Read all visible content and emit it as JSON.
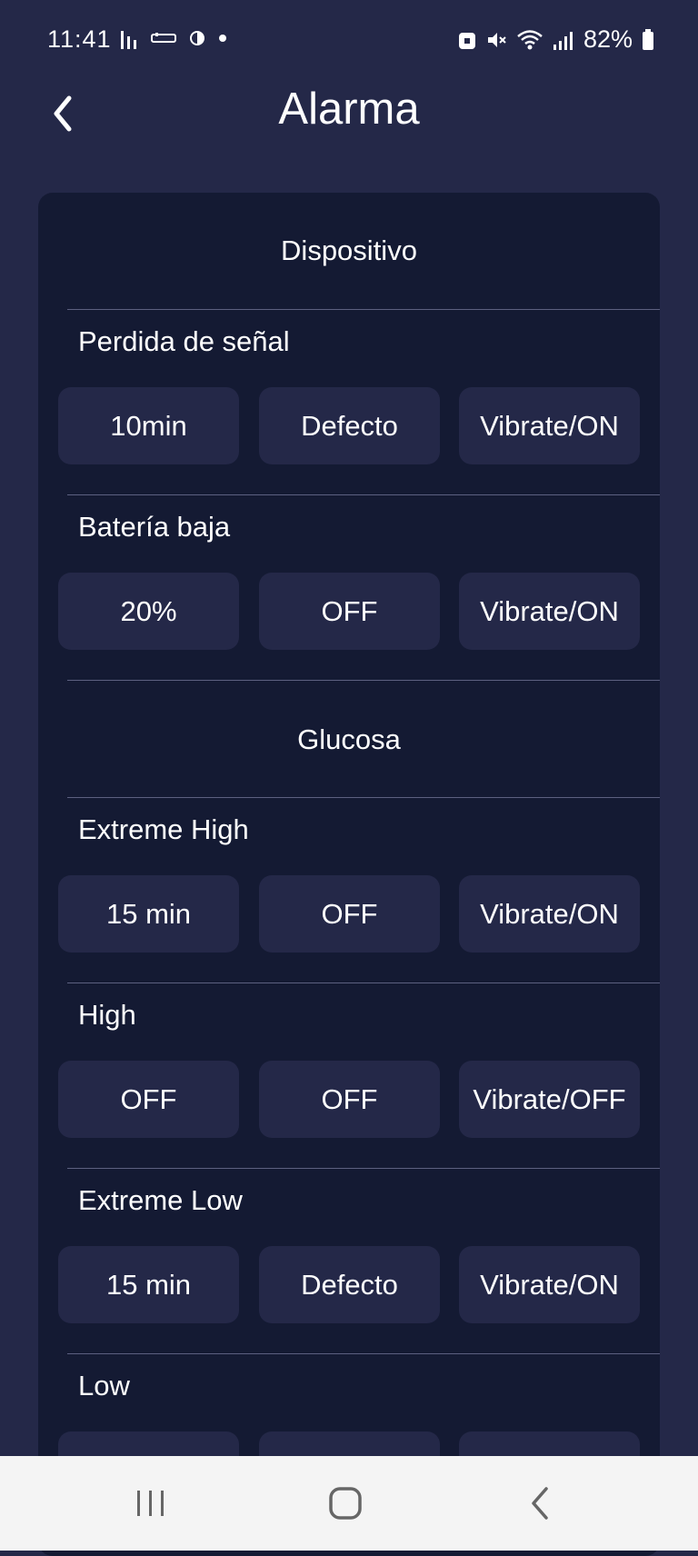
{
  "status": {
    "time": "11:41",
    "battery": "82%",
    "icons": [
      "bar-chart-icon",
      "sim-icon",
      "half-circle-icon",
      "dot-icon",
      "lock-badge-icon",
      "mute-icon",
      "wifi-icon",
      "signal-icon",
      "battery-icon"
    ]
  },
  "header": {
    "title": "Alarma",
    "back_icon": "chevron-left-icon"
  },
  "sections": [
    {
      "title": "Dispositivo",
      "rows": [
        {
          "label": "Perdida de señal",
          "options": [
            "10min",
            "Defecto",
            "Vibrate/ON"
          ]
        },
        {
          "label": "Batería baja",
          "options": [
            "20%",
            "OFF",
            "Vibrate/ON"
          ]
        }
      ]
    },
    {
      "title": "Glucosa",
      "rows": [
        {
          "label": "Extreme High",
          "options": [
            "15 min",
            "OFF",
            "Vibrate/ON"
          ]
        },
        {
          "label": "High",
          "options": [
            "OFF",
            "OFF",
            "Vibrate/OFF"
          ]
        },
        {
          "label": "Extreme Low",
          "options": [
            "15 min",
            "Defecto",
            "Vibrate/ON"
          ]
        },
        {
          "label": "Low",
          "options": [
            "",
            "",
            ""
          ]
        }
      ]
    }
  ],
  "navbar": {
    "icons": [
      "recent-apps-icon",
      "home-icon",
      "back-icon"
    ]
  },
  "colors": {
    "background": "#242848",
    "card": "#141a33",
    "button": "#242848",
    "divider": "#5c6080"
  }
}
